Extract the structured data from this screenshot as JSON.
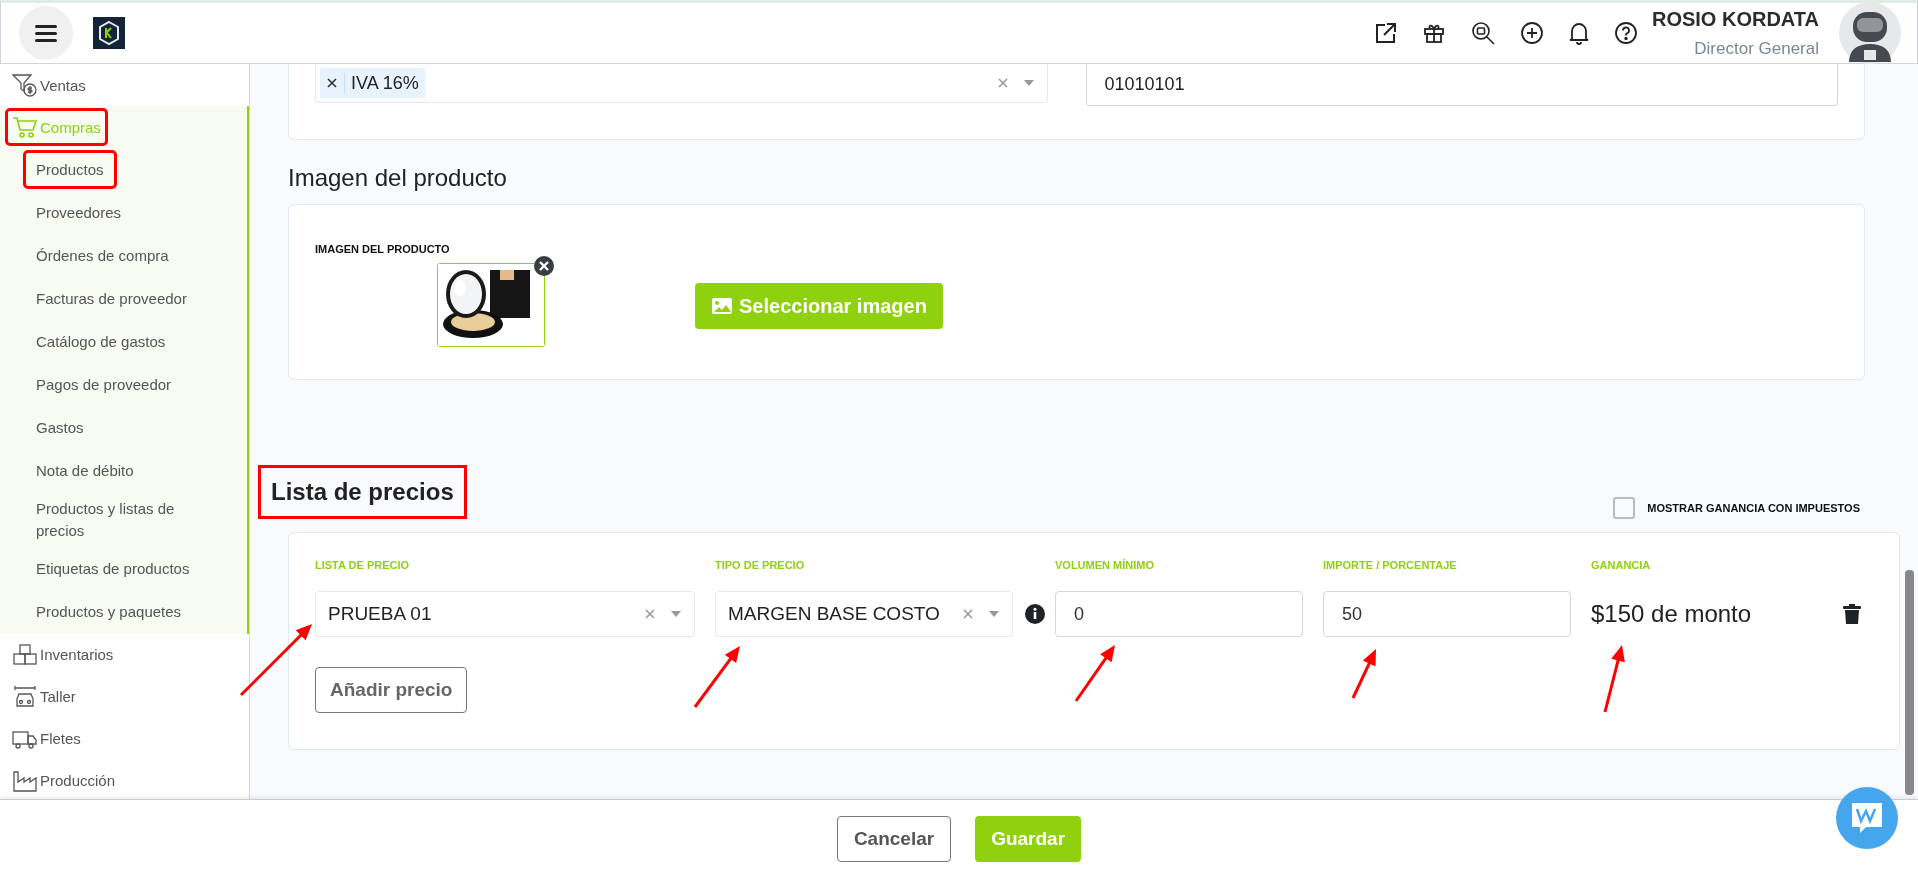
{
  "header": {
    "user_name": "ROSIO KORDATA",
    "user_role": "Director General"
  },
  "sidebar": {
    "items": [
      {
        "label": "Ventas",
        "selected": false,
        "highlighted": false
      },
      {
        "label": "Compras",
        "selected": true,
        "highlighted": true,
        "expanded": true,
        "children": [
          {
            "label": "Productos",
            "highlighted": true
          },
          {
            "label": "Proveedores",
            "highlighted": false
          },
          {
            "label": "Órdenes de compra",
            "highlighted": false
          },
          {
            "label": "Facturas de proveedor",
            "highlighted": false
          },
          {
            "label": "Catálogo de gastos",
            "highlighted": false
          },
          {
            "label": "Pagos de proveedor",
            "highlighted": false
          },
          {
            "label": "Gastos",
            "highlighted": false
          },
          {
            "label": "Nota de débito",
            "highlighted": false
          },
          {
            "label": "Productos y listas de precios",
            "highlighted": false
          },
          {
            "label": "Etiquetas de productos",
            "highlighted": false
          },
          {
            "label": "Productos y paquetes",
            "highlighted": false
          }
        ]
      },
      {
        "label": "Inventarios",
        "selected": false,
        "highlighted": false
      },
      {
        "label": "Taller",
        "selected": false,
        "highlighted": false
      },
      {
        "label": "Fletes",
        "selected": false,
        "highlighted": false
      },
      {
        "label": "Producción",
        "selected": false,
        "highlighted": false
      }
    ]
  },
  "top_card": {
    "tax_tags": [
      "IVA 16%"
    ],
    "code_value": "01010101"
  },
  "image_section": {
    "title": "Imagen del producto",
    "label": "IMAGEN DEL PRODUCTO",
    "button": "Seleccionar imagen"
  },
  "price_list": {
    "title": "Lista de precios",
    "highlighted": true,
    "show_tax_profit": {
      "label": "MOSTRAR GANANCIA CON IMPUESTOS",
      "checked": false
    },
    "columns": [
      "LISTA DE PRECIO",
      "TIPO DE PRECIO",
      "VOLUMEN MÍNIMO",
      "IMPORTE / PORCENTAJE",
      "GANANCIA"
    ],
    "rows": [
      {
        "price_list": "PRUEBA 01",
        "price_type": "MARGEN BASE COSTO",
        "min_volume": "0",
        "amount": "50",
        "profit": "$150 de monto"
      }
    ],
    "add_button": "Añadir precio"
  },
  "footer": {
    "buttons": [
      {
        "label": "Cancelar",
        "kind": "secondary"
      },
      {
        "label": "Guardar",
        "kind": "primary"
      }
    ]
  }
}
